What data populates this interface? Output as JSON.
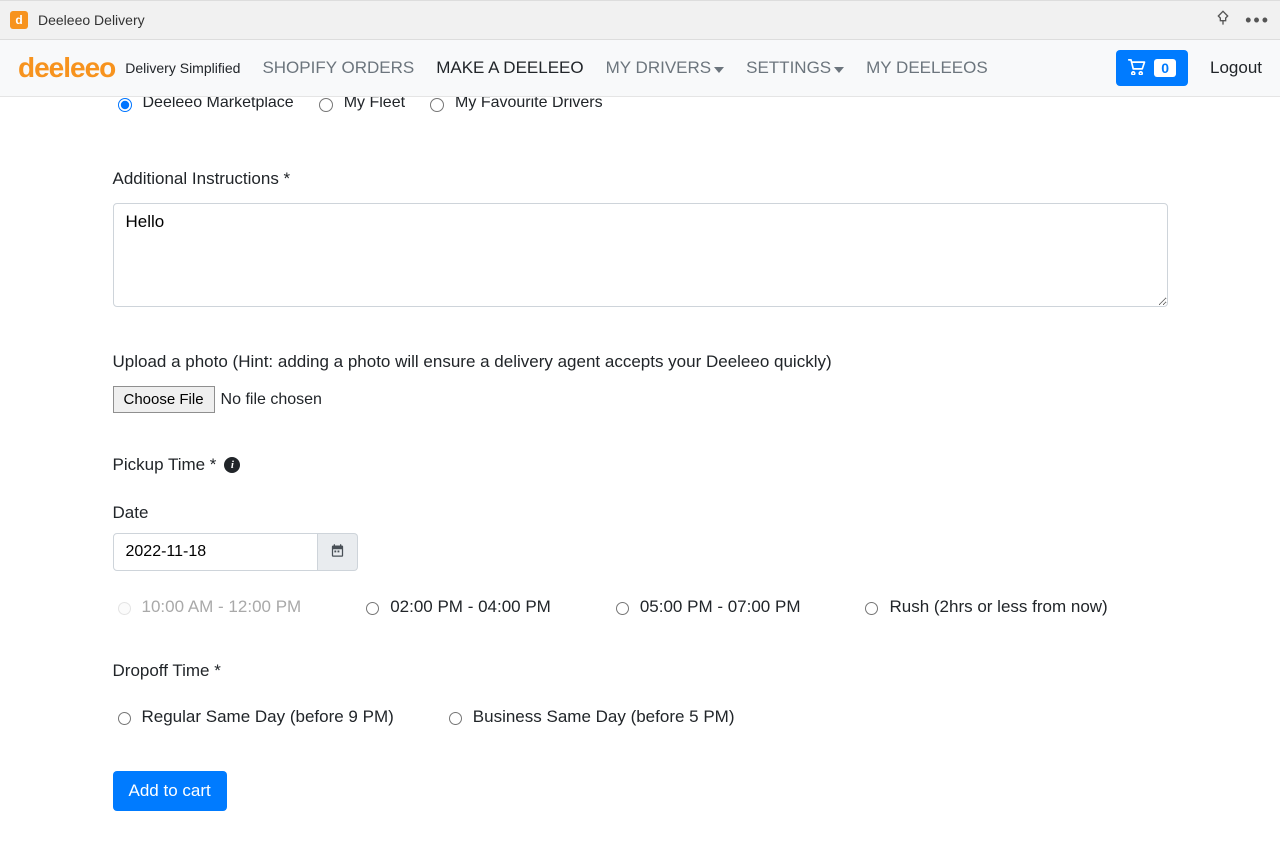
{
  "chrome": {
    "title": "Deeleeo Delivery"
  },
  "header": {
    "brand": "deeleeo",
    "tagline": "Delivery Simplified",
    "nav": {
      "shopify": "SHOPIFY ORDERS",
      "make": "MAKE A DEELEEO",
      "drivers": "MY DRIVERS",
      "settings": "SETTINGS",
      "mydeeleeos": "MY DEELEEOS"
    },
    "cart_count": "0",
    "logout": "Logout"
  },
  "form": {
    "deliver_with": {
      "marketplace": "Deeleeo Marketplace",
      "fleet": "My Fleet",
      "favourite": "My Favourite Drivers"
    },
    "instructions_label": "Additional Instructions *",
    "instructions_value": "Hello",
    "upload_label": "Upload a photo (Hint: adding a photo will ensure a delivery agent accepts your Deeleeo quickly)",
    "choose_file": "Choose File",
    "no_file": "No file chosen",
    "pickup_label": "Pickup Time *",
    "date_label": "Date",
    "date_value": "2022-11-18",
    "slots": {
      "s1": "10:00 AM - 12:00 PM",
      "s2": "02:00 PM - 04:00 PM",
      "s3": "05:00 PM - 07:00 PM",
      "s4": "Rush (2hrs or less from now)"
    },
    "dropoff_label": "Dropoff Time *",
    "dropoff": {
      "regular": "Regular Same Day (before 9 PM)",
      "business": "Business Same Day (before 5 PM)"
    },
    "add_to_cart": "Add to cart"
  }
}
